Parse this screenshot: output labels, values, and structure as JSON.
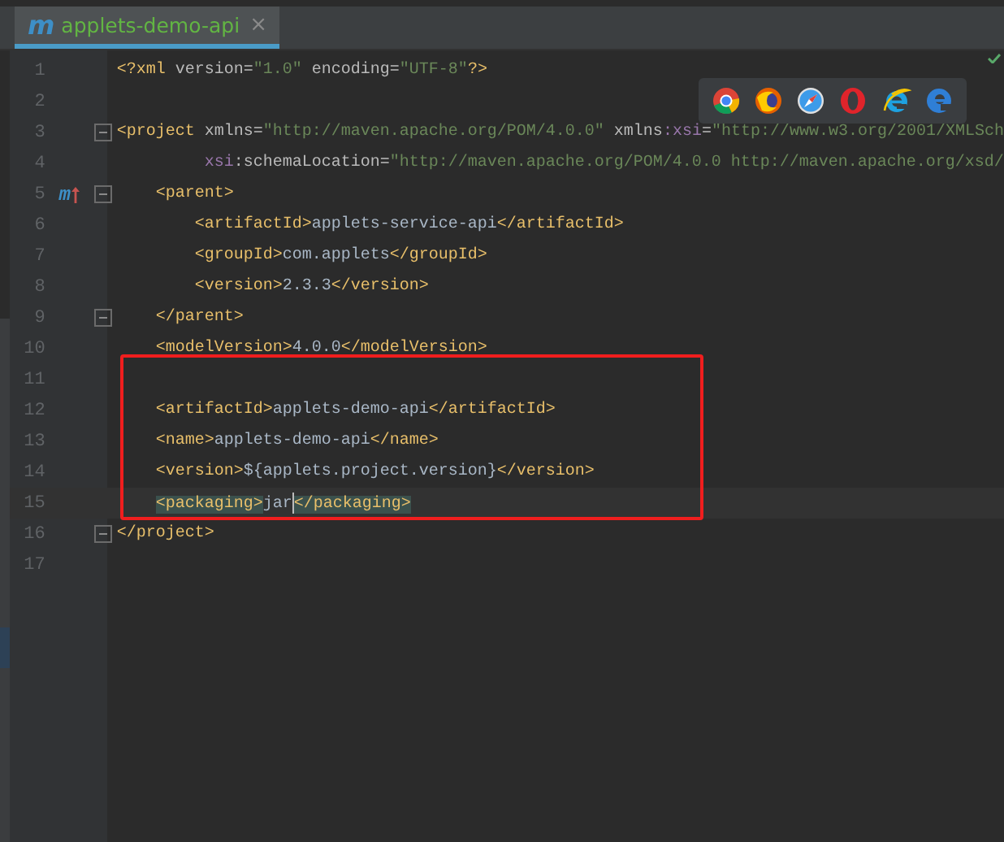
{
  "tab": {
    "title": "applets-demo-api",
    "icon": "m",
    "close": "×",
    "selected": true
  },
  "lines": [
    {
      "number": "1",
      "segments": [
        {
          "kind": "punct",
          "text": "<?"
        },
        {
          "kind": "tag",
          "text": "xml "
        },
        {
          "kind": "attr",
          "text": "version="
        },
        {
          "kind": "value",
          "text": "\"1.0\""
        },
        {
          "kind": "attr",
          "text": " encoding="
        },
        {
          "kind": "value",
          "text": "\"UTF-8\""
        },
        {
          "kind": "punct",
          "text": "?>"
        }
      ]
    },
    {
      "number": "2"
    },
    {
      "number": "3",
      "fold": true,
      "segments": [
        {
          "kind": "tag",
          "text": "<project "
        },
        {
          "kind": "attr",
          "text": "xmlns="
        },
        {
          "kind": "value",
          "text": "\"http://maven.apache.org/POM/4.0.0\""
        },
        {
          "kind": "attr",
          "text": " xmlns"
        },
        {
          "kind": "ns",
          "text": ":xsi"
        },
        {
          "kind": "attr",
          "text": "="
        },
        {
          "kind": "value",
          "text": "\"http://www.w3.org/2001/XMLSch"
        }
      ]
    },
    {
      "number": "4",
      "segments": [
        {
          "kind": "ns",
          "text": "         xsi"
        },
        {
          "kind": "attr",
          "text": ":schemaLocation="
        },
        {
          "kind": "value",
          "text": "\"http://maven.apache.org/POM/4.0.0 http://maven.apache.org/xsd/"
        }
      ]
    },
    {
      "number": "5",
      "fold": true,
      "marker": "m",
      "segments": [
        {
          "kind": "tag",
          "text": "    <parent>"
        }
      ]
    },
    {
      "number": "6",
      "segments": [
        {
          "kind": "tag",
          "text": "        <artifactId>"
        },
        {
          "kind": "text",
          "text": "applets-service-api"
        },
        {
          "kind": "tag",
          "text": "</artifactId>"
        }
      ]
    },
    {
      "number": "7",
      "segments": [
        {
          "kind": "tag",
          "text": "        <groupId>"
        },
        {
          "kind": "text",
          "text": "com.applets"
        },
        {
          "kind": "tag",
          "text": "</groupId>"
        }
      ]
    },
    {
      "number": "8",
      "segments": [
        {
          "kind": "tag",
          "text": "        <version>"
        },
        {
          "kind": "text",
          "text": "2.3.3"
        },
        {
          "kind": "tag",
          "text": "</version>"
        }
      ]
    },
    {
      "number": "9",
      "fold": true,
      "segments": [
        {
          "kind": "tag",
          "text": "    </parent>"
        }
      ]
    },
    {
      "number": "10",
      "segments": [
        {
          "kind": "tag",
          "text": "    <modelVersion>"
        },
        {
          "kind": "text",
          "text": "4.0.0"
        },
        {
          "kind": "tag",
          "text": "</modelVersion>"
        }
      ]
    },
    {
      "number": "11"
    },
    {
      "number": "12",
      "segments": [
        {
          "kind": "tag",
          "text": "    <artifactId>"
        },
        {
          "kind": "text",
          "text": "applets-demo-api"
        },
        {
          "kind": "tag",
          "text": "</artifactId>"
        }
      ]
    },
    {
      "number": "13",
      "segments": [
        {
          "kind": "tag",
          "text": "    <name>"
        },
        {
          "kind": "text",
          "text": "applets-demo-api"
        },
        {
          "kind": "tag",
          "text": "</name>"
        }
      ]
    },
    {
      "number": "14",
      "segments": [
        {
          "kind": "tag",
          "text": "    <version>"
        },
        {
          "kind": "text",
          "text": "${applets.project.version}"
        },
        {
          "kind": "tag",
          "text": "</version>"
        }
      ]
    },
    {
      "number": "15",
      "current": true,
      "segments": [
        {
          "kind": "match",
          "text": "<packaging>",
          "indent": true
        },
        {
          "kind": "text",
          "text": "jar",
          "caret": true
        },
        {
          "kind": "match",
          "text": "</packaging>"
        }
      ]
    },
    {
      "number": "16",
      "fold": true,
      "segments": [
        {
          "kind": "tag",
          "text": "</project>"
        }
      ]
    },
    {
      "number": "17"
    }
  ],
  "browsers": [
    {
      "kind": "chrome"
    },
    {
      "kind": "firefox"
    },
    {
      "kind": "safari"
    },
    {
      "kind": "opera"
    },
    {
      "kind": "ie"
    },
    {
      "kind": "edge"
    }
  ]
}
